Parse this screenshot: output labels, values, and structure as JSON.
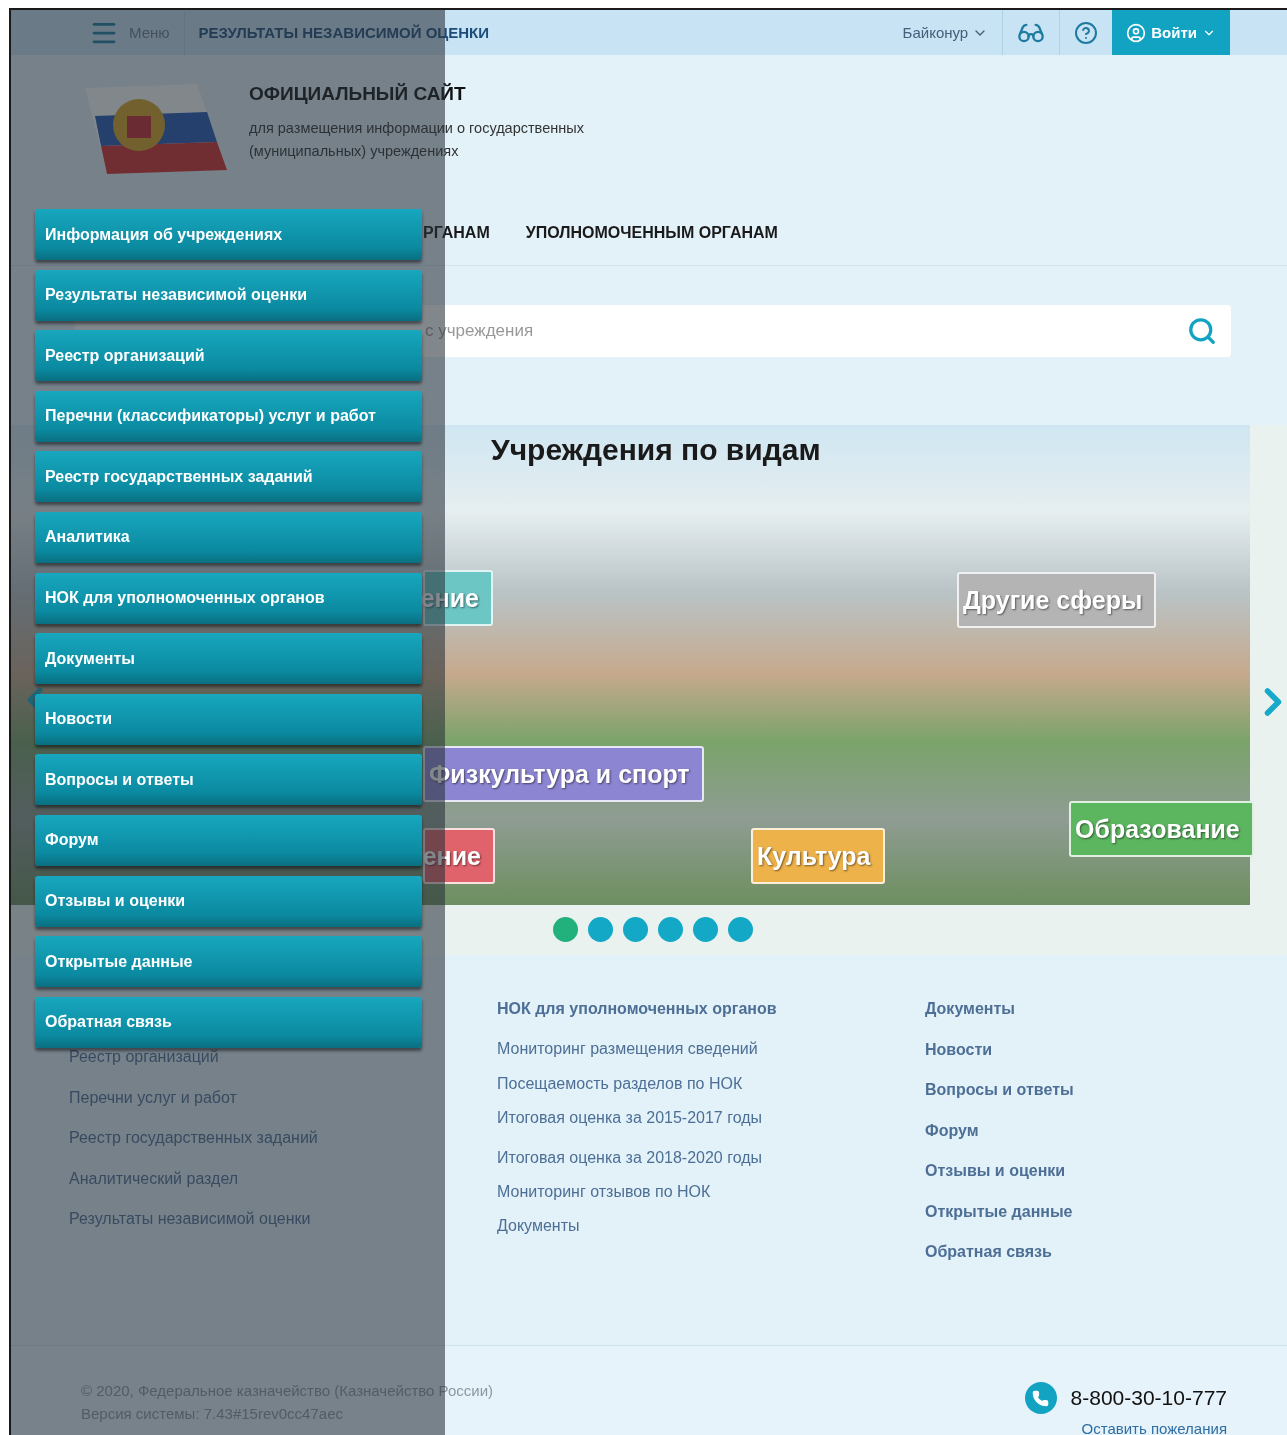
{
  "top_bar": {
    "menu_label": "Меню",
    "section_title": "РЕЗУЛЬТАТЫ НЕЗАВИСИМОЙ ОЦЕНКИ",
    "region": "Байконур",
    "login": "Войти"
  },
  "header": {
    "title": "ОФИЦИАЛЬНЫЙ САЙТ",
    "subtitle_lines": [
      "для размещения информации о государственных",
      "(муниципальных) учреждениях"
    ]
  },
  "nav": {
    "items": [
      "РГАНАМ",
      "УПОЛНОМОЧЕННЫМ ОРГАНАМ"
    ]
  },
  "search": {
    "placeholder": "с учреждения"
  },
  "carousel": {
    "title": "Учреждения по видам",
    "labels": [
      {
        "text": "ение",
        "color": "#6cc6c4"
      },
      {
        "text": "Другие сферы",
        "color": "#b4b4b4"
      },
      {
        "text": "Физкультура и спорт",
        "color": "#8c85d2"
      },
      {
        "text": "ение",
        "color": "#e0636b"
      },
      {
        "text": "Культура",
        "color": "#eeb24a"
      },
      {
        "text": "Образование",
        "color": "#5cb660"
      }
    ],
    "dots": [
      {
        "selected": true
      },
      {
        "selected": false
      },
      {
        "selected": false
      },
      {
        "selected": false
      },
      {
        "selected": false
      },
      {
        "selected": false
      }
    ]
  },
  "footer_links": {
    "columns": [
      [
        "Реестр организаций",
        "Перечни услуг и работ",
        "Реестр государственных заданий",
        "Аналитический раздел",
        "Результаты независимой оценки"
      ],
      [
        "НОК для уполномоченных органов",
        "Мониторинг размещения сведений",
        "Посещаемость разделов по НОК",
        "Итоговая оценка за 2015-2017 годы",
        "Итоговая оценка за 2018-2020 годы",
        "Мониторинг отзывов по НОК",
        "Документы"
      ],
      [
        "Документы",
        "Новости",
        "Вопросы и ответы",
        "Форум",
        "Отзывы и оценки",
        "Открытые данные",
        "Обратная связь"
      ]
    ]
  },
  "footer": {
    "copyright": "© 2020, Федеральное казначейство (Казначейство России)",
    "version": "Версия системы: 7.43#15rev0cc47aec",
    "phone": "8-800-30-10-777",
    "feedback_link": "Оставить пожелания"
  },
  "side_menu": {
    "items": [
      "Информация об учреждениях",
      "Результаты независимой оценки",
      "Реестр организаций",
      "Перечни (классификаторы) услуг и работ",
      "Реестр государственных заданий",
      "Аналитика",
      "НОК для уполномоченных органов",
      "Документы",
      "Новости",
      "Вопросы и ответы",
      "Форум",
      "Отзывы и оценки",
      "Открытые данные",
      "Обратная связь"
    ]
  }
}
